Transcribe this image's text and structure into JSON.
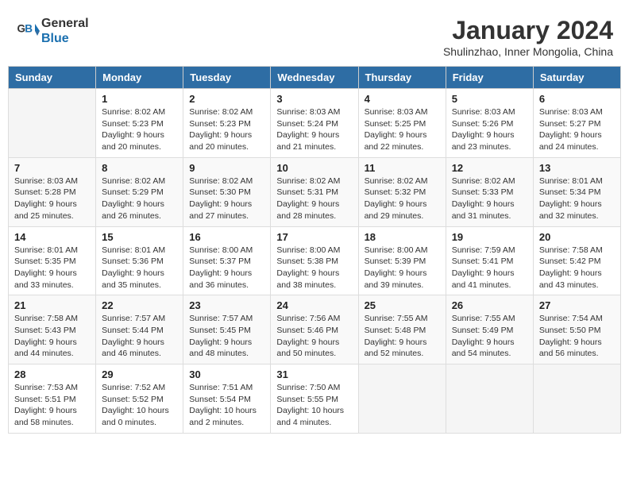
{
  "header": {
    "logo_line1": "General",
    "logo_line2": "Blue",
    "month": "January 2024",
    "location": "Shulinzhao, Inner Mongolia, China"
  },
  "days_of_week": [
    "Sunday",
    "Monday",
    "Tuesday",
    "Wednesday",
    "Thursday",
    "Friday",
    "Saturday"
  ],
  "weeks": [
    [
      {
        "day": "",
        "text": ""
      },
      {
        "day": "1",
        "text": "Sunrise: 8:02 AM\nSunset: 5:23 PM\nDaylight: 9 hours\nand 20 minutes."
      },
      {
        "day": "2",
        "text": "Sunrise: 8:02 AM\nSunset: 5:23 PM\nDaylight: 9 hours\nand 20 minutes."
      },
      {
        "day": "3",
        "text": "Sunrise: 8:03 AM\nSunset: 5:24 PM\nDaylight: 9 hours\nand 21 minutes."
      },
      {
        "day": "4",
        "text": "Sunrise: 8:03 AM\nSunset: 5:25 PM\nDaylight: 9 hours\nand 22 minutes."
      },
      {
        "day": "5",
        "text": "Sunrise: 8:03 AM\nSunset: 5:26 PM\nDaylight: 9 hours\nand 23 minutes."
      },
      {
        "day": "6",
        "text": "Sunrise: 8:03 AM\nSunset: 5:27 PM\nDaylight: 9 hours\nand 24 minutes."
      }
    ],
    [
      {
        "day": "7",
        "text": "Sunrise: 8:03 AM\nSunset: 5:28 PM\nDaylight: 9 hours\nand 25 minutes."
      },
      {
        "day": "8",
        "text": "Sunrise: 8:02 AM\nSunset: 5:29 PM\nDaylight: 9 hours\nand 26 minutes."
      },
      {
        "day": "9",
        "text": "Sunrise: 8:02 AM\nSunset: 5:30 PM\nDaylight: 9 hours\nand 27 minutes."
      },
      {
        "day": "10",
        "text": "Sunrise: 8:02 AM\nSunset: 5:31 PM\nDaylight: 9 hours\nand 28 minutes."
      },
      {
        "day": "11",
        "text": "Sunrise: 8:02 AM\nSunset: 5:32 PM\nDaylight: 9 hours\nand 29 minutes."
      },
      {
        "day": "12",
        "text": "Sunrise: 8:02 AM\nSunset: 5:33 PM\nDaylight: 9 hours\nand 31 minutes."
      },
      {
        "day": "13",
        "text": "Sunrise: 8:01 AM\nSunset: 5:34 PM\nDaylight: 9 hours\nand 32 minutes."
      }
    ],
    [
      {
        "day": "14",
        "text": "Sunrise: 8:01 AM\nSunset: 5:35 PM\nDaylight: 9 hours\nand 33 minutes."
      },
      {
        "day": "15",
        "text": "Sunrise: 8:01 AM\nSunset: 5:36 PM\nDaylight: 9 hours\nand 35 minutes."
      },
      {
        "day": "16",
        "text": "Sunrise: 8:00 AM\nSunset: 5:37 PM\nDaylight: 9 hours\nand 36 minutes."
      },
      {
        "day": "17",
        "text": "Sunrise: 8:00 AM\nSunset: 5:38 PM\nDaylight: 9 hours\nand 38 minutes."
      },
      {
        "day": "18",
        "text": "Sunrise: 8:00 AM\nSunset: 5:39 PM\nDaylight: 9 hours\nand 39 minutes."
      },
      {
        "day": "19",
        "text": "Sunrise: 7:59 AM\nSunset: 5:41 PM\nDaylight: 9 hours\nand 41 minutes."
      },
      {
        "day": "20",
        "text": "Sunrise: 7:58 AM\nSunset: 5:42 PM\nDaylight: 9 hours\nand 43 minutes."
      }
    ],
    [
      {
        "day": "21",
        "text": "Sunrise: 7:58 AM\nSunset: 5:43 PM\nDaylight: 9 hours\nand 44 minutes."
      },
      {
        "day": "22",
        "text": "Sunrise: 7:57 AM\nSunset: 5:44 PM\nDaylight: 9 hours\nand 46 minutes."
      },
      {
        "day": "23",
        "text": "Sunrise: 7:57 AM\nSunset: 5:45 PM\nDaylight: 9 hours\nand 48 minutes."
      },
      {
        "day": "24",
        "text": "Sunrise: 7:56 AM\nSunset: 5:46 PM\nDaylight: 9 hours\nand 50 minutes."
      },
      {
        "day": "25",
        "text": "Sunrise: 7:55 AM\nSunset: 5:48 PM\nDaylight: 9 hours\nand 52 minutes."
      },
      {
        "day": "26",
        "text": "Sunrise: 7:55 AM\nSunset: 5:49 PM\nDaylight: 9 hours\nand 54 minutes."
      },
      {
        "day": "27",
        "text": "Sunrise: 7:54 AM\nSunset: 5:50 PM\nDaylight: 9 hours\nand 56 minutes."
      }
    ],
    [
      {
        "day": "28",
        "text": "Sunrise: 7:53 AM\nSunset: 5:51 PM\nDaylight: 9 hours\nand 58 minutes."
      },
      {
        "day": "29",
        "text": "Sunrise: 7:52 AM\nSunset: 5:52 PM\nDaylight: 10 hours\nand 0 minutes."
      },
      {
        "day": "30",
        "text": "Sunrise: 7:51 AM\nSunset: 5:54 PM\nDaylight: 10 hours\nand 2 minutes."
      },
      {
        "day": "31",
        "text": "Sunrise: 7:50 AM\nSunset: 5:55 PM\nDaylight: 10 hours\nand 4 minutes."
      },
      {
        "day": "",
        "text": ""
      },
      {
        "day": "",
        "text": ""
      },
      {
        "day": "",
        "text": ""
      }
    ]
  ]
}
